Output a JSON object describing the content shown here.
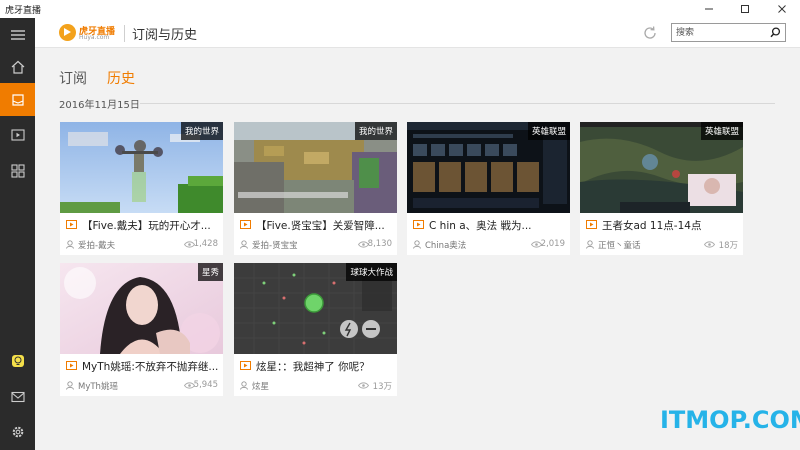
{
  "window": {
    "title": "虎牙直播"
  },
  "header": {
    "logo_name": "虎牙直播",
    "logo_domain": "Huya.com",
    "page_title": "订阅与历史",
    "search_placeholder": "搜索"
  },
  "tabs": {
    "subscribe": "订阅",
    "history": "历史"
  },
  "date_label": "2016年11月15日",
  "colors": {
    "accent": "#f07c00",
    "sidebar": "#2b2b2b",
    "content_bg": "#f2f2f2",
    "watermark": "#26b3e8"
  },
  "sidebar_icons": [
    "menu-icon",
    "home-icon",
    "bookmark-icon",
    "video-icon",
    "grid-icon",
    "bulb-icon",
    "mail-icon",
    "gear-icon"
  ],
  "cards": [
    {
      "badge": "我的世界",
      "title": "【Five.戴夫】玩的开心才...",
      "author": "爱拍-戴夫",
      "views": "1,428"
    },
    {
      "badge": "我的世界",
      "title": "【Five.贤宝宝】关爱智障...",
      "author": "爱拍-贤宝宝",
      "views": "8,130"
    },
    {
      "badge": "英雄联盟",
      "title": "C hin a、奥法 戦为...",
      "author": "China奥法",
      "views": "2,019"
    },
    {
      "badge": "英雄联盟",
      "title": "王者女ad 11点-14点",
      "author": "正恒丶童话",
      "views": "18万"
    },
    {
      "badge": "星秀",
      "title": "MyTh姚瑶:不放弃不抛弃继...",
      "author": "MyTh姚瑶",
      "views": "5,945"
    },
    {
      "badge": "球球大作战",
      "title": "炫星：：我超神了 你呢？",
      "author": "炫星",
      "views": "13万"
    }
  ],
  "watermark": "ITMOP.COM"
}
